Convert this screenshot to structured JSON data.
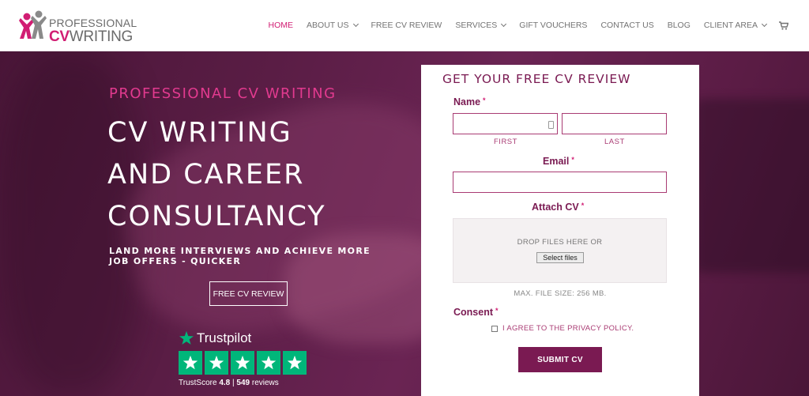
{
  "header": {
    "logo": {
      "line1": "PROFESSIONAL",
      "cv": "CV",
      "writing": "WRITING"
    },
    "nav": [
      {
        "label": "HOME",
        "active": true,
        "dropdown": false
      },
      {
        "label": "ABOUT US",
        "active": false,
        "dropdown": true
      },
      {
        "label": "FREE CV REVIEW",
        "active": false,
        "dropdown": false
      },
      {
        "label": "SERVICES",
        "active": false,
        "dropdown": true
      },
      {
        "label": "GIFT VOUCHERS",
        "active": false,
        "dropdown": false
      },
      {
        "label": "CONTACT US",
        "active": false,
        "dropdown": false
      },
      {
        "label": "BLOG",
        "active": false,
        "dropdown": false
      },
      {
        "label": "CLIENT AREA",
        "active": false,
        "dropdown": true
      }
    ],
    "cart_icon": "shopping-cart-icon"
  },
  "hero": {
    "subtitle": "PROFESSIONAL CV WRITING",
    "title_lines": [
      "CV WRITING",
      "AND CAREER",
      "CONSULTANCY"
    ],
    "tagline": "LAND MORE INTERVIEWS AND ACHIEVE MORE JOB OFFERS - QUICKER",
    "button": "FREE CV REVIEW"
  },
  "trustpilot": {
    "name": "Trustpilot",
    "stars": 5,
    "score_label": "TrustScore",
    "score": "4.8",
    "separator": "|",
    "reviews": "549",
    "reviews_label": "reviews"
  },
  "form": {
    "title": "GET YOUR FREE CV REVIEW",
    "name_label": "Name",
    "first_label": "FIRST",
    "last_label": "LAST",
    "first_value": "",
    "last_value": "",
    "email_label": "Email",
    "email_value": "",
    "attach_label": "Attach CV",
    "drop_text": "DROP FILES HERE OR",
    "select_button": "Select files",
    "max_size": "MAX. FILE SIZE: 256 MB.",
    "consent_label": "Consent",
    "consent_text": "I AGREE TO THE PRIVACY POLICY.",
    "consent_checked": false,
    "required_marker": "*",
    "submit": "SUBMIT CV"
  },
  "colors": {
    "brand_pink": "#d11d73",
    "brand_plum": "#7a1a52",
    "trustpilot_green": "#00b67a"
  }
}
